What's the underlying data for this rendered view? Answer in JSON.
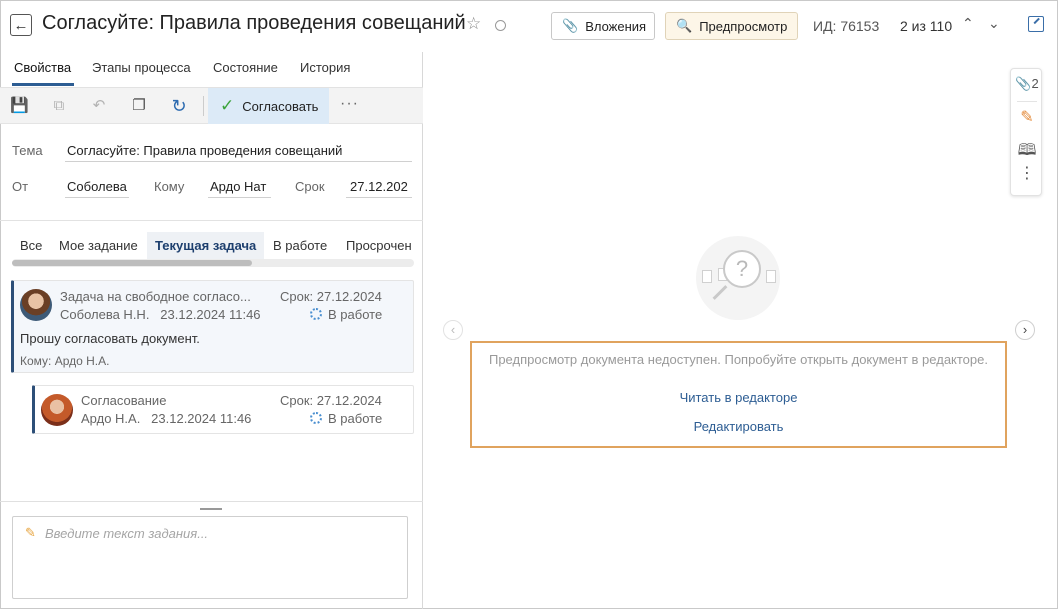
{
  "header": {
    "title": "Согласуйте: Правила проведения совещаний",
    "attachments_label": "Вложения",
    "preview_label": "Предпросмотр",
    "id_text": "ИД: 76153",
    "count_text": "2 из 110"
  },
  "tabs": [
    "Свойства",
    "Этапы процесса",
    "Состояние",
    "История"
  ],
  "toolbar": {
    "approve_label": "Согласовать"
  },
  "form": {
    "subject_label": "Тема",
    "subject_value": "Согласуйте: Правила проведения совещаний",
    "from_label": "От",
    "from_value": "Соболева",
    "to_label": "Кому",
    "to_value": "Ардо Нат",
    "due_label": "Срок",
    "due_value": "27.12.202"
  },
  "filters": [
    "Все",
    "Мое задание",
    "Текущая задача",
    "В работе",
    "Просрочен"
  ],
  "tasks": [
    {
      "title": "Задача на свободное согласо...",
      "author": "Соболева Н.Н.",
      "date": "23.12.2024 11:46",
      "due": "Срок: 27.12.2024",
      "status": "В работе",
      "message": "Прошу согласовать документ.",
      "recipient": "Кому: Ардо Н.А."
    },
    {
      "title": "Согласование",
      "author": "Ардо Н.А.",
      "date": "23.12.2024 11:46",
      "due": "Срок: 27.12.2024",
      "status": "В работе"
    }
  ],
  "task_input": {
    "placeholder": "Введите текст задания..."
  },
  "side_rail": {
    "attachments_count": "2"
  },
  "preview": {
    "unavailable_text": "Предпросмотр документа недоступен. Попробуйте открыть документ в редакторе.",
    "read_link": "Читать в редакторе",
    "edit_link": "Редактировать"
  }
}
